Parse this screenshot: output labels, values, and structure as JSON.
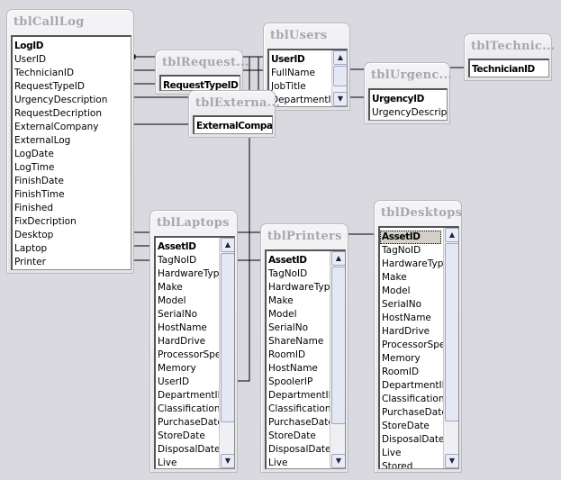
{
  "tables": [
    {
      "id": "calllog",
      "name": "tblCallLog",
      "fields": [
        "LogID",
        "UserID",
        "TechnicianID",
        "RequestTypeID",
        "UrgencyDescription",
        "RequestDecription",
        "ExternalCompany",
        "ExternalLog",
        "LogDate",
        "LogTime",
        "FinishDate",
        "FinishTime",
        "Finished",
        "FixDecription",
        "Desktop",
        "Laptop",
        "Printer"
      ],
      "pk": [
        "LogID"
      ]
    },
    {
      "id": "request",
      "name": "tblRequest...",
      "fields": [
        "RequestTypeID"
      ],
      "pk": [
        "RequestTypeID"
      ]
    },
    {
      "id": "users",
      "name": "tblUsers",
      "fields": [
        "UserID",
        "FullName",
        "JobTitle",
        "DepartmentID"
      ],
      "pk": [
        "UserID"
      ],
      "scroll": true
    },
    {
      "id": "external",
      "name": "tblExterna...",
      "fields": [
        "ExternalCompany"
      ],
      "pk": [
        "ExternalCompany"
      ]
    },
    {
      "id": "urgency",
      "name": "tblUrgenc...",
      "fields": [
        "UrgencyID",
        "UrgencyDescription"
      ],
      "pk": [
        "UrgencyID"
      ]
    },
    {
      "id": "technic",
      "name": "tblTechnic...",
      "fields": [
        "TechnicianID"
      ],
      "pk": [
        "TechnicianID"
      ]
    },
    {
      "id": "laptops",
      "name": "tblLaptops",
      "fields": [
        "AssetID",
        "TagNoID",
        "HardwareType",
        "Make",
        "Model",
        "SerialNo",
        "HostName",
        "HardDrive",
        "ProcessorSpeed",
        "Memory",
        "UserID",
        "DepartmentID",
        "ClassificationID",
        "PurchaseDate",
        "StoreDate",
        "DisposalDate",
        "Live"
      ],
      "pk": [
        "AssetID"
      ],
      "scroll": true
    },
    {
      "id": "printers",
      "name": "tblPrinters",
      "fields": [
        "AssetID",
        "TagNoID",
        "HardwareType",
        "Make",
        "Model",
        "SerialNo",
        "ShareName",
        "RoomID",
        "HostName",
        "SpoolerIP",
        "DepartmentID",
        "ClassificationID",
        "PurchaseDate",
        "StoreDate",
        "DisposalDate",
        "Live"
      ],
      "pk": [
        "AssetID"
      ],
      "scroll": true
    },
    {
      "id": "desktops",
      "name": "tblDesktops",
      "fields": [
        "AssetID",
        "TagNoID",
        "HardwareType",
        "Make",
        "Model",
        "SerialNo",
        "HostName",
        "HardDrive",
        "ProcessorSpeed",
        "Memory",
        "RoomID",
        "DepartmentID",
        "ClassificationID",
        "PurchaseDate",
        "StoreDate",
        "DisposalDate",
        "Live",
        "Stored"
      ],
      "pk": [
        "AssetID"
      ],
      "selected": "AssetID",
      "scroll": true
    }
  ]
}
